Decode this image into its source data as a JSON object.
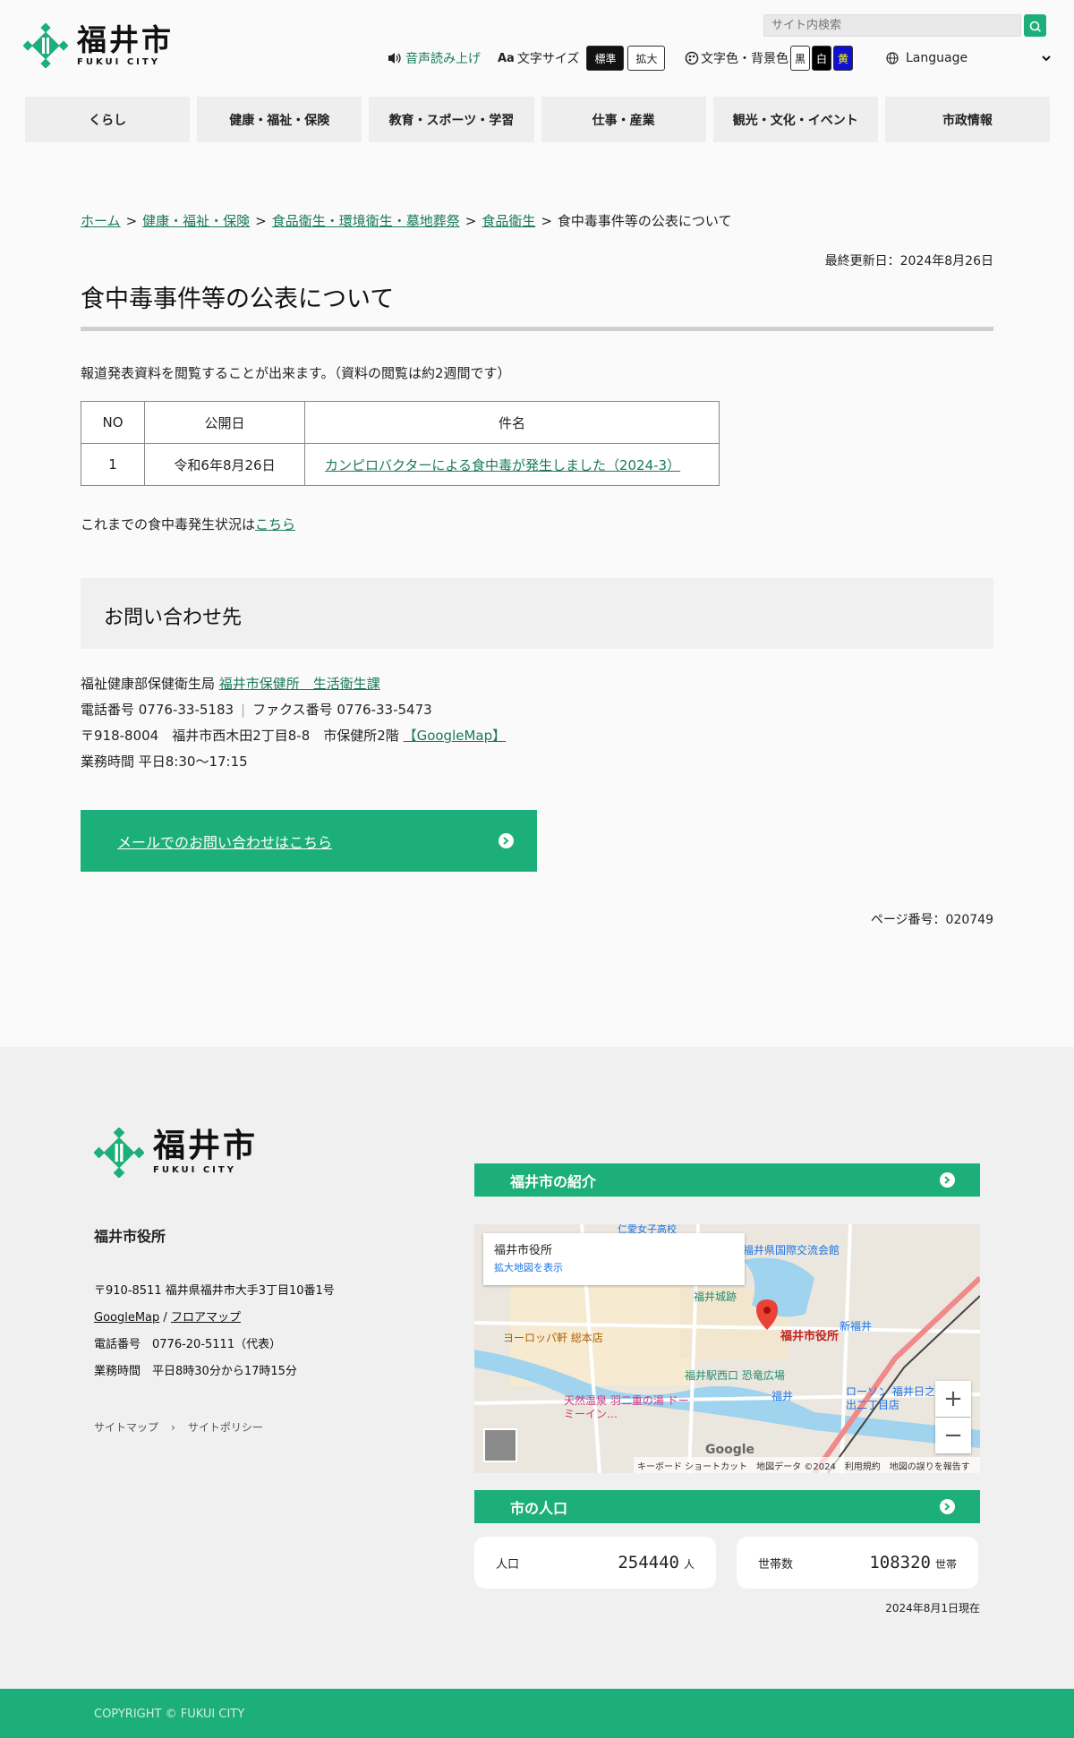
{
  "header": {
    "logo": {
      "main": "福井市",
      "sub": "FUKUI CITY"
    },
    "search": {
      "placeholder": "サイト内検索"
    },
    "speech": "音声読み上げ",
    "font_size": {
      "label": "文字サイズ",
      "standard": "標準",
      "large": "拡大"
    },
    "color": {
      "label": "文字色・背景色",
      "black": "黒",
      "white": "白",
      "yellow": "黄"
    },
    "language": "Language"
  },
  "nav": [
    "くらし",
    "健康・福祉・保険",
    "教育・スポーツ・学習",
    "仕事・産業",
    "観光・文化・イベント",
    "市政情報"
  ],
  "breadcrumb": {
    "home": "ホーム",
    "l1": "健康・福祉・保険",
    "l2": "食品衛生・環境衛生・墓地葬祭",
    "l3": "食品衛生",
    "current": "食中毒事件等の公表について",
    "sep": ">"
  },
  "updated": "最終更新日：2024年8月26日",
  "title": "食中毒事件等の公表について",
  "intro": "報道発表資料を閲覧することが出来ます。（資料の閲覧は約2週間です）",
  "table": {
    "headers": [
      "NO",
      "公開日",
      "件名"
    ],
    "rows": [
      {
        "no": "1",
        "date": "令和6年8月26日",
        "subject": "カンピロバクターによる食中毒が発生しました（2024-3）"
      }
    ]
  },
  "past": {
    "text": "これまでの食中毒発生状況は",
    "link": "こちら"
  },
  "inquiry": {
    "heading": "お問い合わせ先",
    "dept": "福祉健康部保健衛生局 ",
    "dept_link": "福井市保健所　生活衛生課",
    "phone": "電話番号 0776-33-5183",
    "fax": "ファクス番号 0776-33-5473",
    "address": "〒918-8004　福井市西木田2丁目8-8　市保健所2階 ",
    "map_link": "【GoogleMap】",
    "hours": "業務時間 平日8:30〜17:15",
    "mail_button": "メールでのお問い合わせはこちら"
  },
  "page_number": "ページ番号：020749",
  "footer": {
    "logo": {
      "main": "福井市",
      "sub": "FUKUI CITY"
    },
    "office": "福井市役所",
    "address": "〒910-8511 福井県福井市大手3丁目10番1号",
    "map_link": "GoogleMap",
    "slash": " / ",
    "floor_link": "フロアマップ",
    "phone": "電話番号　0776-20-5111（代表）",
    "hours": "業務時間　平日8時30分から17時15分",
    "sitemap": "サイトマップ",
    "policy": "サイトポリシー",
    "intro_band": "福井市の紹介",
    "pop_band": "市の人口",
    "map": {
      "card_title": "福井市役所",
      "card_link": "拡大地図を表示",
      "pin_label": "福井市役所",
      "google": "Google",
      "attribution": "キーボード ショートカット　地図データ ©2024　利用規約　地図の誤りを報告する",
      "places": [
        "福井城跡",
        "新福井",
        "ヨーロッパ軒 総本店",
        "福井駅西口 恐竜広場",
        "福井",
        "天然温泉 羽二重の湯 ドーミーイン…",
        "ローソン 福井日之出二丁目店",
        "福井県国際交流会館",
        "仁愛女子高校"
      ]
    },
    "population": {
      "label": "人口",
      "value": "254440",
      "unit": "人"
    },
    "households": {
      "label": "世帯数",
      "value": "108320",
      "unit": "世帯"
    },
    "as_of": "2024年8月1日現在",
    "copyright": "COPYRIGHT © FUKUI CITY"
  },
  "colors": {
    "accent": "#1daf7a",
    "link": "#1a7a5a"
  }
}
